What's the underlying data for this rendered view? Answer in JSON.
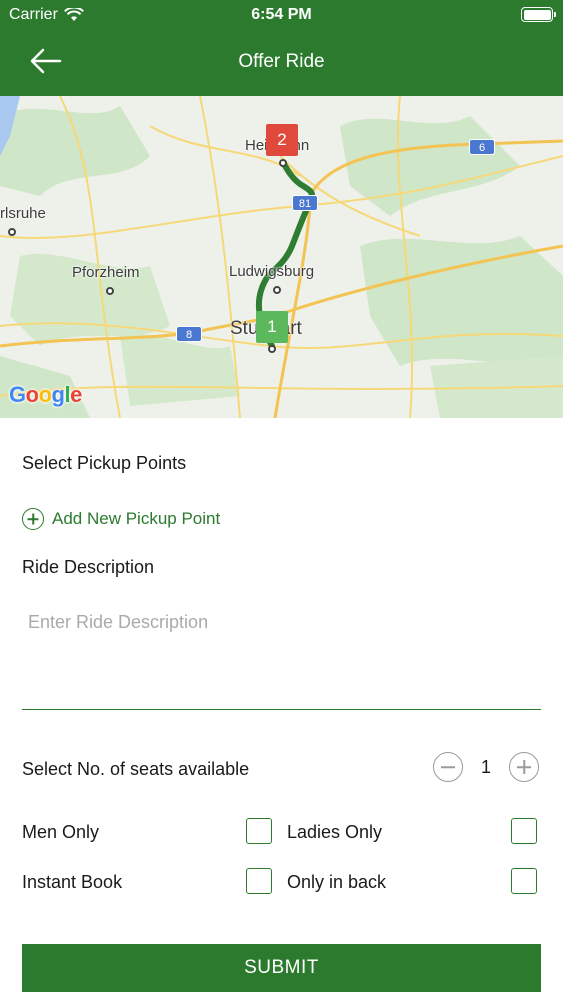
{
  "status_bar": {
    "carrier": "Carrier",
    "time": "6:54 PM"
  },
  "nav": {
    "title": "Offer Ride"
  },
  "map": {
    "cities": {
      "heilbronn": "Heilbronn",
      "karlsruhe": "rlsruhe",
      "pforzheim": "Pforzheim",
      "ludwigsburg": "Ludwigsburg",
      "stuttgart": "Stuttgart"
    },
    "highway_shields": {
      "a6": "6",
      "a81": "81",
      "a8": "8"
    },
    "markers": {
      "start": "1",
      "end": "2"
    },
    "attribution": "Google",
    "route_color": "#2e7d32"
  },
  "form": {
    "pickup_heading": "Select Pickup Points",
    "add_pickup_label": "Add New Pickup Point",
    "description_heading": "Ride Description",
    "description_placeholder": "Enter Ride Description",
    "seats_label": "Select No. of seats available",
    "seats_value": "1",
    "options": {
      "men_only": "Men Only",
      "ladies_only": "Ladies Only",
      "instant_book": "Instant Book",
      "only_in_back": "Only in back"
    },
    "submit_label": "SUBMIT"
  },
  "colors": {
    "primary": "#2b7a2e"
  }
}
